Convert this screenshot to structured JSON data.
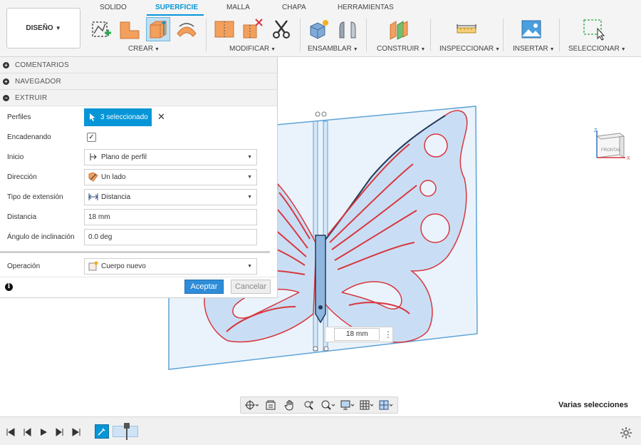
{
  "workspace": {
    "label": "DISEÑO"
  },
  "tabs": [
    {
      "label": "SOLIDO",
      "active": false
    },
    {
      "label": "SUPERFICIE",
      "active": true
    },
    {
      "label": "MALLA",
      "active": false
    },
    {
      "label": "CHAPA",
      "active": false
    },
    {
      "label": "HERRAMIENTAS",
      "active": false
    }
  ],
  "groups": {
    "crear": "CREAR",
    "modificar": "MODIFICAR",
    "ensamblar": "ENSAMBLAR",
    "construir": "CONSTRUIR",
    "inspeccionar": "INSPECCIONAR",
    "insertar": "INSERTAR",
    "seleccionar": "SELECCIONAR"
  },
  "panel": {
    "sections": {
      "comentarios": "COMENTARIOS",
      "navegador": "NAVEGADOR",
      "extruir": "EXTRUIR"
    },
    "perfiles": {
      "label": "Perfiles",
      "value": "3 seleccionado"
    },
    "encadenando": {
      "label": "Encadenando",
      "checked": true
    },
    "inicio": {
      "label": "Inicio",
      "value": "Plano de perfil"
    },
    "direccion": {
      "label": "Dirección",
      "value": "Un lado"
    },
    "tipo_extension": {
      "label": "Tipo de extensión",
      "value": "Distancia"
    },
    "distancia": {
      "label": "Distancia",
      "value": "18 mm"
    },
    "angulo": {
      "label": "Ángulo de inclinación",
      "value": "0.0 deg"
    },
    "operacion": {
      "label": "Operación",
      "value": "Cuerpo nuevo"
    },
    "ok": "Aceptar",
    "cancel": "Cancelar"
  },
  "canvas": {
    "dimension_value": "18 mm",
    "viewcube_label": "FRONTAL",
    "viewcube_axes": {
      "x": "X",
      "z": "Z"
    },
    "status": "Varias selecciones"
  },
  "colors": {
    "accent": "#0696d7",
    "sketch_line": "#d9363e",
    "body_fill": "#c9def4",
    "plane": "#5ea3d6"
  }
}
